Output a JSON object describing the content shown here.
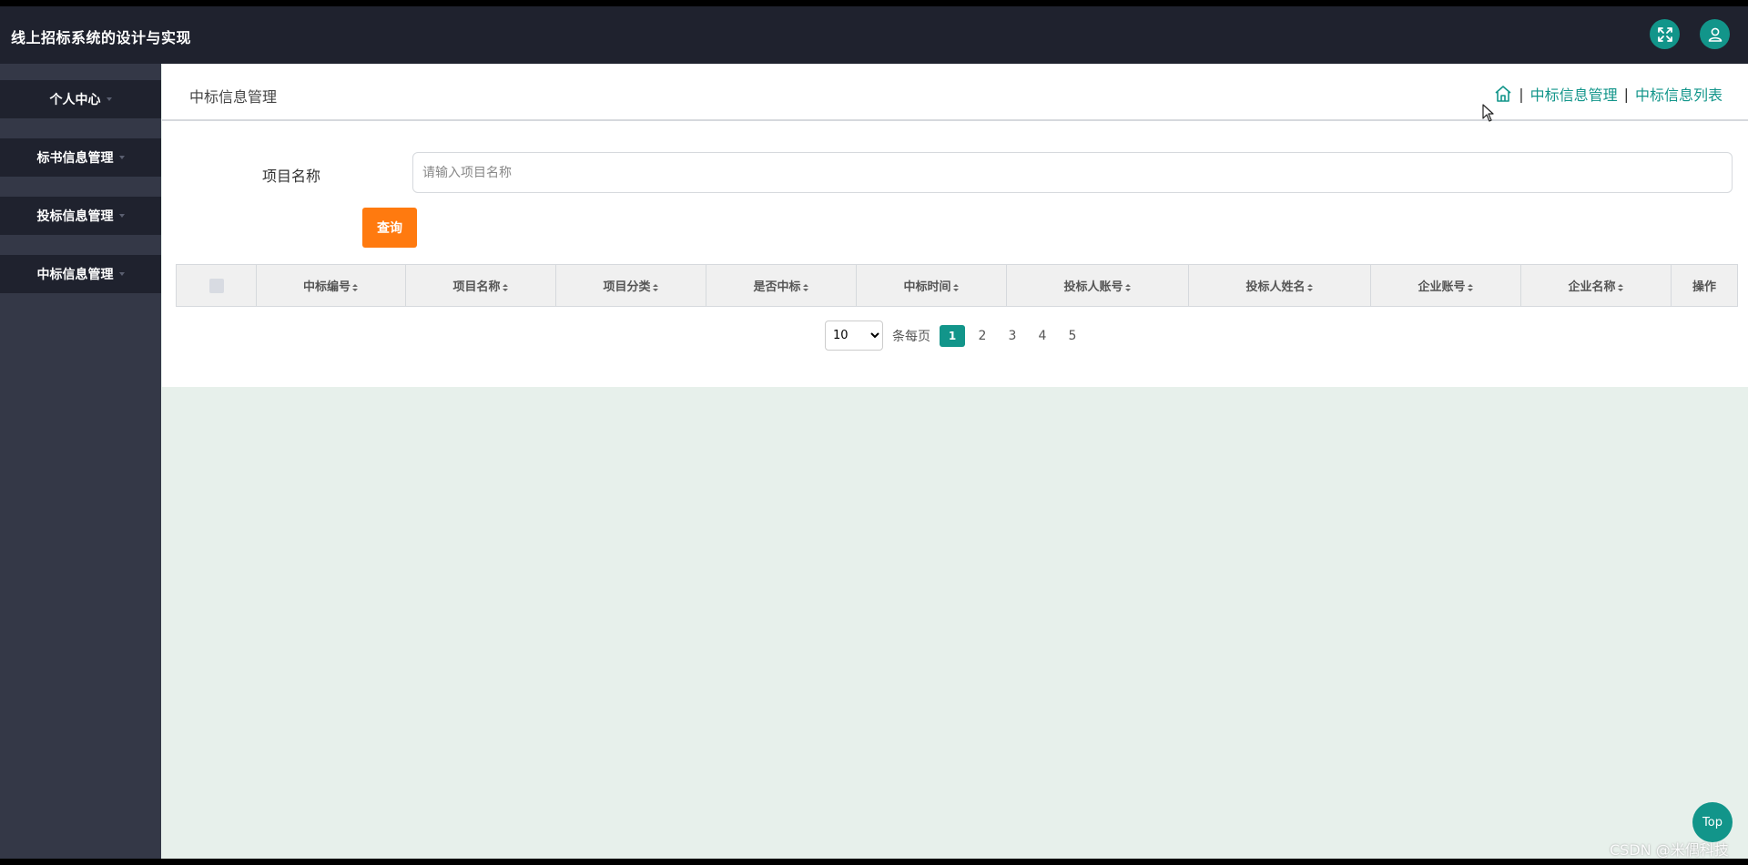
{
  "header": {
    "title": "线上招标系统的设计与实现",
    "fullscreen_icon": "expand-arrows-icon",
    "user_icon": "user-icon"
  },
  "sidebar": {
    "items": [
      {
        "label": "个人中心"
      },
      {
        "label": "标书信息管理"
      },
      {
        "label": "投标信息管理"
      },
      {
        "label": "中标信息管理"
      }
    ]
  },
  "page": {
    "title": "中标信息管理",
    "breadcrumb": {
      "home_icon": "home-icon",
      "crumb1": "中标信息管理",
      "crumb2": "中标信息列表",
      "separator": "|"
    }
  },
  "search": {
    "label": "项目名称",
    "placeholder": "请输入项目名称",
    "value": "",
    "button": "查询"
  },
  "table": {
    "columns": [
      "中标编号",
      "项目名称",
      "项目分类",
      "是否中标",
      "中标时间",
      "投标人账号",
      "投标人姓名",
      "企业账号",
      "企业名称",
      "操作"
    ],
    "rows": []
  },
  "pagination": {
    "page_size": "10",
    "page_size_options": [
      "10"
    ],
    "per_page_label": "条每页",
    "pages": [
      "1",
      "2",
      "3",
      "4",
      "5"
    ],
    "current": "1"
  },
  "float": {
    "top_label": "Top"
  },
  "watermark": "CSDN @米偶科技",
  "colors": {
    "header_bg": "#1f222e",
    "sidebar_bg": "#343847",
    "accent": "#12958a",
    "query_button": "#ff7a0f",
    "content_bg": "#e7f0eb"
  }
}
